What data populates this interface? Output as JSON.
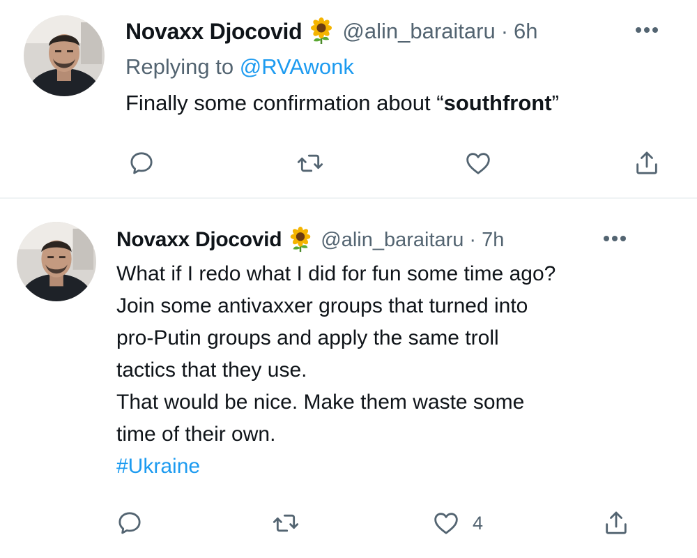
{
  "tweets": [
    {
      "name": "Novaxx Djocovid",
      "handle": "@alin_baraitaru",
      "separator": "·",
      "time": "6h",
      "replying_prefix": "Replying to",
      "replying_to": "@RVAwonk",
      "text_prefix": "Finally some confirmation about “",
      "text_bold": "southfront",
      "text_suffix": "”",
      "likes": ""
    },
    {
      "name": "Novaxx Djocovid",
      "handle": "@alin_baraitaru",
      "separator": "·",
      "time": "7h",
      "lines": [
        "What if I redo what I did for fun some time ago?",
        "Join some antivaxxer groups that turned into",
        "pro-Putin groups and apply the same troll",
        "tactics that they use.",
        "That would be nice. Make them waste some",
        "time of their own."
      ],
      "hashtag": "#Ukraine",
      "likes": "4"
    }
  ],
  "icons": {
    "name_emoji": "sunflower-icon",
    "reply": "reply-icon",
    "retweet": "retweet-icon",
    "like": "heart-icon",
    "share": "share-icon",
    "more": "more-icon"
  },
  "colors": {
    "link": "#1d9bf0",
    "secondary_text": "#536471",
    "primary_text": "#0f1419",
    "divider": "#eff3f4"
  }
}
